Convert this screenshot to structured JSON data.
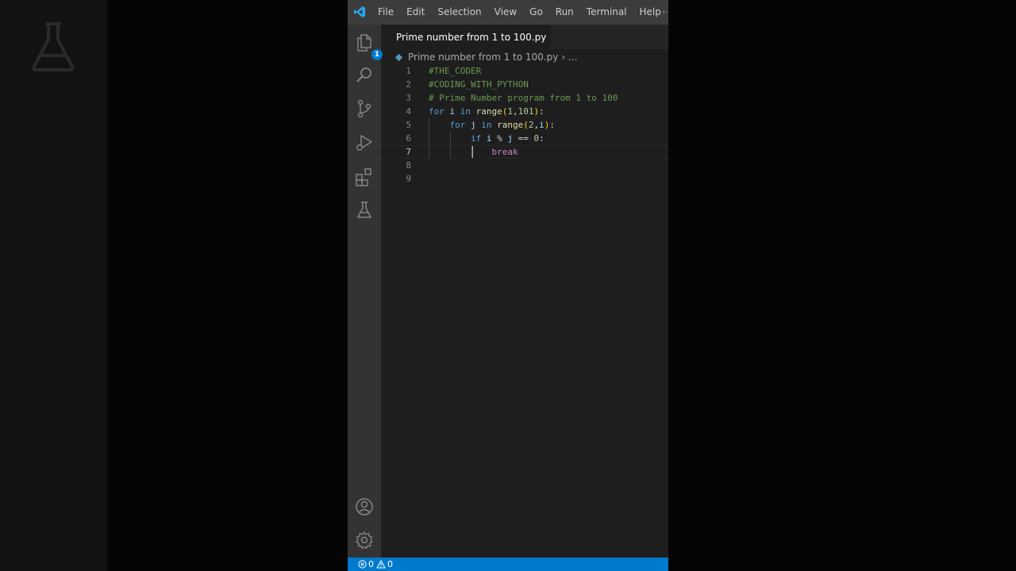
{
  "colors": {
    "accent": "#007acc",
    "editor_bg": "#1e1e1e",
    "titlebar_bg": "#3c3c3c",
    "activitybar_bg": "#333333"
  },
  "menu": [
    "File",
    "Edit",
    "Selection",
    "View",
    "Go",
    "Run",
    "Terminal",
    "Help"
  ],
  "activitybar": {
    "top_icons": [
      "files-icon",
      "search-icon",
      "source-control-icon",
      "run-debug-icon",
      "extensions-icon",
      "testing-icon"
    ],
    "explorer_badge": "1",
    "bottom_icons": [
      "account-icon",
      "gear-icon"
    ]
  },
  "tab": {
    "label": "Prime number from 1 to 100.py",
    "modified": true
  },
  "breadcrumb": {
    "file": "Prime number from 1 to 100.py",
    "more": "..."
  },
  "editor": {
    "current_line": 7,
    "lines": [
      {
        "num": "1",
        "text": "#THE_CODER"
      },
      {
        "num": "2",
        "text": "#CODING_WITH_PYTHON"
      },
      {
        "num": "3",
        "text": "# Prime Number program from 1 to 100"
      },
      {
        "num": "4",
        "text": "for i in range(1,101):"
      },
      {
        "num": "5",
        "text": "    for j in range(2,i):"
      },
      {
        "num": "6",
        "text": "        if i % j == 0:"
      },
      {
        "num": "7",
        "text": "            break"
      },
      {
        "num": "8",
        "text": ""
      },
      {
        "num": "9",
        "text": ""
      }
    ]
  },
  "status": {
    "errors": "0",
    "warnings": "0"
  }
}
